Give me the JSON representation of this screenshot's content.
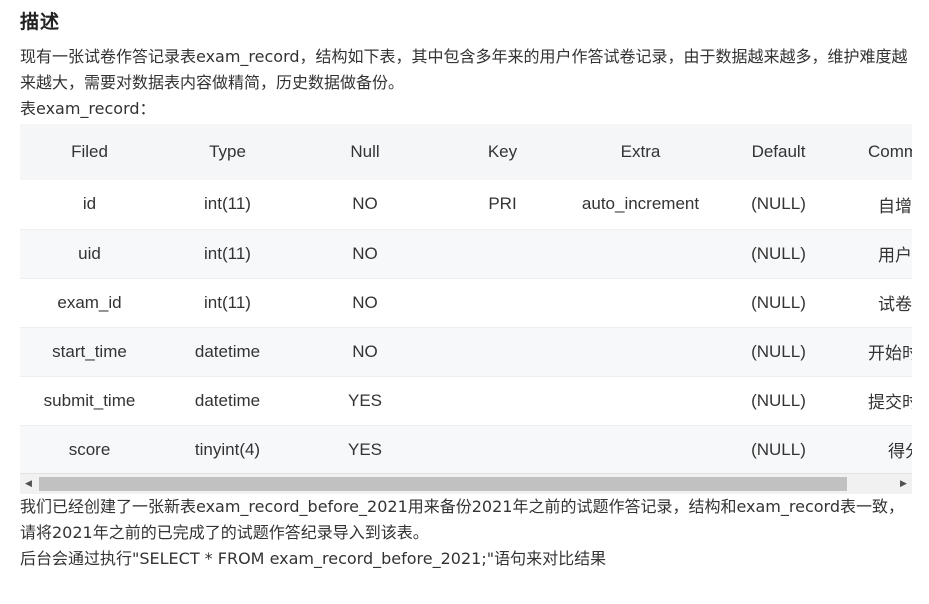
{
  "section": {
    "title": "描述",
    "intro": "现有一张试卷作答记录表exam_record，结构如下表，其中包含多年来的用户作答试卷记录，由于数据越来越多，维护难度越来越大，需要对数据表内容做精简，历史数据做备份。",
    "table_caption": "表exam_record：",
    "after_text": "我们已经创建了一张新表exam_record_before_2021用来备份2021年之前的试题作答记录，结构和exam_record表一致，请将2021年之前的已完成了的试题作答纪录导入到该表。",
    "check_text": "后台会通过执行\"SELECT * FROM exam_record_before_2021;\"语句来对比结果"
  },
  "table": {
    "headers": [
      "Filed",
      "Type",
      "Null",
      "Key",
      "Extra",
      "Default",
      "Comment"
    ],
    "rows": [
      [
        "id",
        "int(11)",
        "NO",
        "PRI",
        "auto_increment",
        "(NULL)",
        "自增ID"
      ],
      [
        "uid",
        "int(11)",
        "NO",
        "",
        "",
        "(NULL)",
        "用户ID"
      ],
      [
        "exam_id",
        "int(11)",
        "NO",
        "",
        "",
        "(NULL)",
        "试卷ID"
      ],
      [
        "start_time",
        "datetime",
        "NO",
        "",
        "",
        "(NULL)",
        "开始时间"
      ],
      [
        "submit_time",
        "datetime",
        "YES",
        "",
        "",
        "(NULL)",
        "提交时间"
      ],
      [
        "score",
        "tinyint(4)",
        "YES",
        "",
        "",
        "(NULL)",
        "得分"
      ]
    ]
  },
  "scrollbar": {
    "left_arrow": "◀",
    "right_arrow": "▶"
  }
}
